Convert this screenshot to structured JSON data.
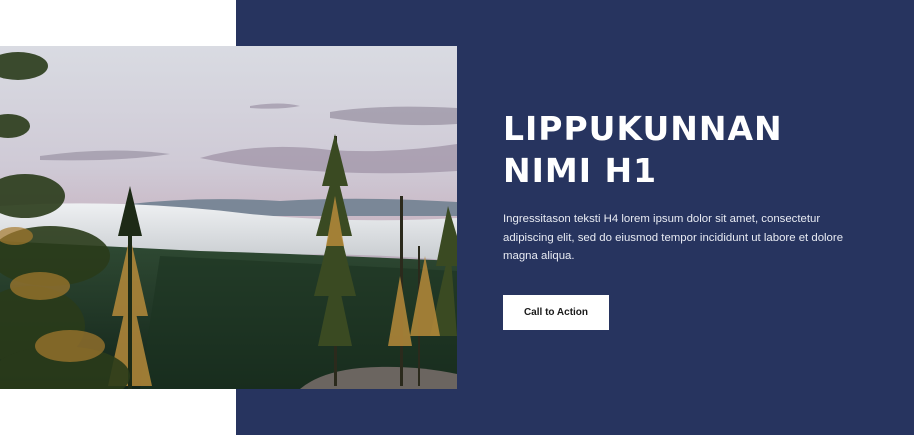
{
  "hero": {
    "title_line1": "LIPPUKUNNAN",
    "title_line2": "NIMI H1",
    "body": "Ingressitason teksti H4 lorem ipsum dolor sit amet, consectetur adipiscing elit, sed do eiusmod tempor incididunt ut labore et dolore magna aliqua.",
    "cta_label": "Call to Action"
  },
  "colors": {
    "panel": "#27345f",
    "button_bg": "#ffffff",
    "button_text": "#1a1a1a"
  }
}
